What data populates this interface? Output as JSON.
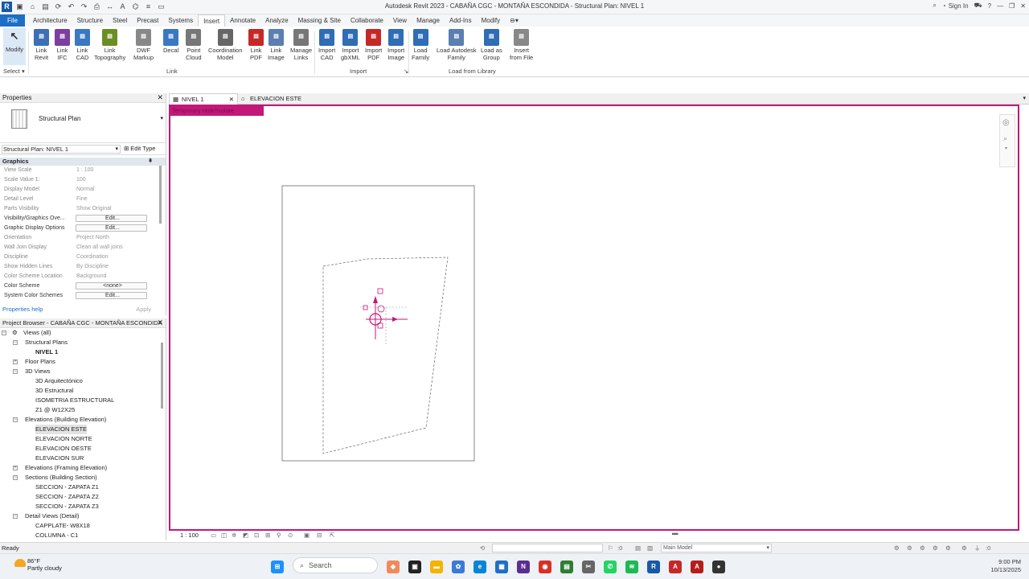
{
  "titlebar": {
    "window_title": "Autodesk Revit 2023 - CABAÑA CGC - MONTAÑA ESCONDIDA - Structural Plan: NIVEL 1",
    "sign_in": "Sign In"
  },
  "menu": {
    "tabs": [
      "File",
      "Architecture",
      "Structure",
      "Steel",
      "Precast",
      "Systems",
      "Insert",
      "Annotate",
      "Analyze",
      "Massing & Site",
      "Collaborate",
      "View",
      "Manage",
      "Add-Ins",
      "Modify"
    ],
    "active_tab": "Insert"
  },
  "ribbon": {
    "modify": "Modify",
    "select": "Select",
    "link_buttons": [
      {
        "label": "Link\nRevit",
        "icon": "link-revit-icon"
      },
      {
        "label": "Link\nIFC",
        "icon": "link-ifc-icon"
      },
      {
        "label": "Link\nCAD",
        "icon": "link-cad-icon"
      },
      {
        "label": "Link\nTopography",
        "icon": "link-topography-icon"
      },
      {
        "label": "DWF\nMarkup",
        "icon": "dwf-markup-icon"
      },
      {
        "label": "Decal",
        "icon": "decal-icon"
      },
      {
        "label": "Point\nCloud",
        "icon": "point-cloud-icon"
      },
      {
        "label": "Coordination\nModel",
        "icon": "coordination-model-icon"
      },
      {
        "label": "Link\nPDF",
        "icon": "link-pdf-icon"
      },
      {
        "label": "Link\nImage",
        "icon": "link-image-icon"
      },
      {
        "label": "Manage\nLinks",
        "icon": "manage-links-icon"
      }
    ],
    "import_buttons": [
      {
        "label": "Import\nCAD",
        "icon": "import-cad-icon"
      },
      {
        "label": "Import\ngbXML",
        "icon": "import-gbxml-icon"
      },
      {
        "label": "Import\nPDF",
        "icon": "import-pdf-icon"
      },
      {
        "label": "Import\nImage",
        "icon": "import-image-icon"
      }
    ],
    "library_buttons": [
      {
        "label": "Load\nFamily",
        "icon": "load-family-icon"
      },
      {
        "label": "Load Autodesk\nFamily",
        "icon": "load-autodesk-family-icon"
      },
      {
        "label": "Load as\nGroup",
        "icon": "load-as-group-icon"
      },
      {
        "label": "Insert\nfrom File",
        "icon": "insert-from-file-icon"
      }
    ],
    "panels": {
      "link": "Link",
      "import": "Import",
      "library": "Load from Library"
    }
  },
  "properties": {
    "title": "Properties",
    "type_name": "Structural Plan",
    "instance": "Structural Plan: NIVEL 1",
    "edit_type": "Edit Type",
    "group": "Graphics",
    "rows": [
      {
        "k": "View Scale",
        "v": "1 : 100"
      },
      {
        "k": "Scale Value    1:",
        "v": "100"
      },
      {
        "k": "Display Model",
        "v": "Normal"
      },
      {
        "k": "Detail Level",
        "v": "Fine"
      },
      {
        "k": "Parts Visibility",
        "v": "Show Original"
      },
      {
        "k": "Visibility/Graphics Ove...",
        "v": "Edit...",
        "btn": true
      },
      {
        "k": "Graphic Display Options",
        "v": "Edit...",
        "btn": true
      },
      {
        "k": "Orientation",
        "v": "Project North"
      },
      {
        "k": "Wall Join Display",
        "v": "Clean all wall joins"
      },
      {
        "k": "Discipline",
        "v": "Coordination"
      },
      {
        "k": "Show Hidden Lines",
        "v": "By Discipline"
      },
      {
        "k": "Color Scheme Location",
        "v": "Background"
      },
      {
        "k": "Color Scheme",
        "v": "<none>",
        "btn": true
      },
      {
        "k": "System Color Schemes",
        "v": "Edit...",
        "btn": true
      }
    ],
    "help": "Properties help",
    "apply": "Apply"
  },
  "browser": {
    "title": "Project Browser - CABAÑA CGC - MONTAÑA ESCONDIDA",
    "items": [
      {
        "t": "Views (all)",
        "lvl": 0,
        "exp": "−"
      },
      {
        "t": "Structural Plans",
        "lvl": 1,
        "exp": "−"
      },
      {
        "t": "NIVEL 1",
        "lvl": 2,
        "bold": true
      },
      {
        "t": "Floor Plans",
        "lvl": 1,
        "exp": "+"
      },
      {
        "t": "3D Views",
        "lvl": 1,
        "exp": "−"
      },
      {
        "t": "3D Arquitectónico",
        "lvl": 2
      },
      {
        "t": "3D Estructural",
        "lvl": 2
      },
      {
        "t": "ISOMETRIA ESTRUCTURAL",
        "lvl": 2
      },
      {
        "t": "Z1 @ W12X25",
        "lvl": 2
      },
      {
        "t": "Elevations (Building Elevation)",
        "lvl": 1,
        "exp": "−"
      },
      {
        "t": "ELEVACION ESTE",
        "lvl": 2,
        "sel": true
      },
      {
        "t": "ELEVACION NORTE",
        "lvl": 2
      },
      {
        "t": "ELEVACION OESTE",
        "lvl": 2
      },
      {
        "t": "ELEVACION SUR",
        "lvl": 2
      },
      {
        "t": "Elevations (Framing Elevation)",
        "lvl": 1,
        "exp": "+"
      },
      {
        "t": "Sections (Building Section)",
        "lvl": 1,
        "exp": "−"
      },
      {
        "t": "SECCION - ZAPATA Z1",
        "lvl": 2
      },
      {
        "t": "SECCION - ZAPATA Z2",
        "lvl": 2
      },
      {
        "t": "SECCION - ZAPATA Z3",
        "lvl": 2
      },
      {
        "t": "Detail Views (Detail)",
        "lvl": 1,
        "exp": "−"
      },
      {
        "t": "CAPPLATE- W8X18",
        "lvl": 2
      },
      {
        "t": "COLUMNA - C1",
        "lvl": 2
      }
    ]
  },
  "viewtabs": [
    {
      "label": "NIVEL 1",
      "active": true
    },
    {
      "label": "ELEVACION ESTE",
      "active": false
    }
  ],
  "canvas": {
    "temp_label": "Temporary Hide/Isolate",
    "accent": "#c3187a"
  },
  "viewctrl": {
    "scale": "1 : 100"
  },
  "status": {
    "text": "Ready",
    "model": "Main Model",
    "count": ":0"
  },
  "taskbar": {
    "temp": "86°F",
    "weather": "Partly cloudy",
    "search": "Search",
    "time": "9:00 PM",
    "date": "10/13/2025"
  }
}
